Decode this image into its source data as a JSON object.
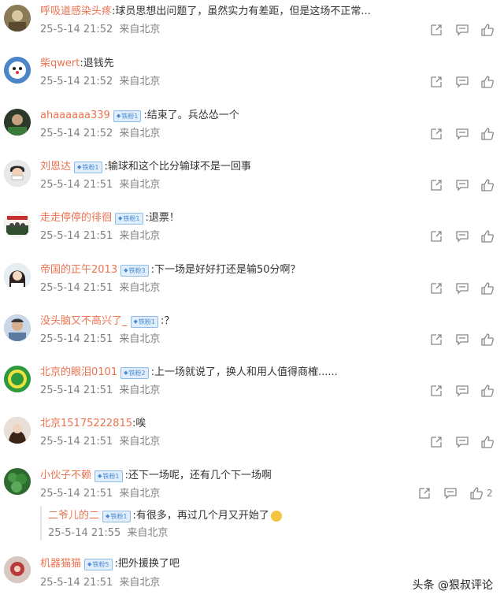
{
  "comments": [
    {
      "user": "呼吸道感染头疼",
      "badge": "",
      "text": ":球员思想出问题了，虽然实力有差距，但是这场不正常...",
      "date": "25-5-14 21:52",
      "source": "来自北京",
      "likes": ""
    },
    {
      "user": "柴qwert",
      "badge": "",
      "text": ":退钱先",
      "date": "25-5-14 21:52",
      "source": "来自北京",
      "likes": ""
    },
    {
      "user": "ahaaaaaa339",
      "badge": "铁粉1",
      "text": ":结束了。兵怂怂一个",
      "date": "25-5-14 21:52",
      "source": "来自北京",
      "likes": ""
    },
    {
      "user": "刘恩达",
      "badge": "铁粉1",
      "text": ":输球和这个比分输球不是一回事",
      "date": "25-5-14 21:51",
      "source": "来自北京",
      "likes": ""
    },
    {
      "user": "走走停停的徘徊",
      "badge": "铁粉1",
      "text": ":退票！",
      "date": "25-5-14 21:51",
      "source": "来自北京",
      "likes": ""
    },
    {
      "user": "帝国的正午2013",
      "badge": "铁粉3",
      "text": ":下一场是好好打还是输50分啊？",
      "date": "25-5-14 21:51",
      "source": "来自北京",
      "likes": ""
    },
    {
      "user": "没头脑又不高兴了_",
      "badge": "铁粉1",
      "text": ":？",
      "date": "25-5-14 21:51",
      "source": "来自北京",
      "likes": ""
    },
    {
      "user": "北京的眼泪0101",
      "badge": "铁粉2",
      "text": ":上一场就说了，换人和用人值得商榷......",
      "date": "25-5-14 21:51",
      "source": "来自北京",
      "likes": ""
    },
    {
      "user": "北京15175222815",
      "badge": "",
      "text": ":唉",
      "date": "25-5-14 21:51",
      "source": "来自北京",
      "likes": ""
    },
    {
      "user": "小伙子不赖",
      "badge": "铁粉1",
      "text": ":还下一场呢，还有几个下一场啊",
      "date": "25-5-14 21:51",
      "source": "来自北京",
      "likes": "2"
    },
    {
      "user": "机器猫猫",
      "badge": "铁粉5",
      "text": ":把外援换了吧",
      "date": "25-5-14 21:51",
      "source": "来自北京",
      "likes": ""
    }
  ],
  "reply": {
    "user": "二爷儿的二",
    "badge": "铁粉1",
    "text": ":有很多，再过几个月又开始了",
    "date": "25-5-14 21:55",
    "source": "来自北京"
  },
  "icons": {
    "share": "share-icon",
    "comment": "comment-icon",
    "like": "like-icon",
    "badge": "fan-badge-icon"
  },
  "colors": {
    "username": "#eb7350",
    "meta": "#808080",
    "badge_bg": "#dfeefa",
    "badge_border": "#8bbbe6"
  },
  "watermark": "头条 @狠叔评论"
}
